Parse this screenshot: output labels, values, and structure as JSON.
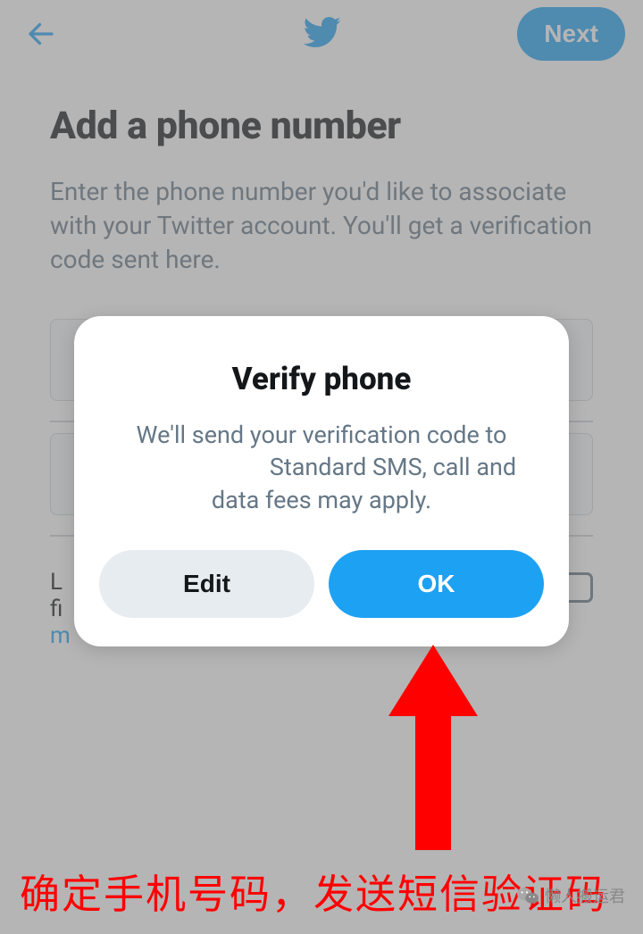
{
  "header": {
    "next_label": "Next"
  },
  "page": {
    "title": "Add a phone number",
    "subtitle": "Enter the phone number you'd like to associate with your Twitter account. You'll get a verification code sent here.",
    "checkbox_text_prefix": "L",
    "checkbox_text_line2": "fi",
    "checkbox_link": "m"
  },
  "modal": {
    "title": "Verify phone",
    "body_line1": "We'll send your verification code to",
    "body_line2": "Standard SMS, call and",
    "body_line3": "data fees may apply.",
    "edit_label": "Edit",
    "ok_label": "OK"
  },
  "annotation": {
    "caption": "确定手机号码，发送短信验证码",
    "watermark": "懒人搬运君"
  }
}
